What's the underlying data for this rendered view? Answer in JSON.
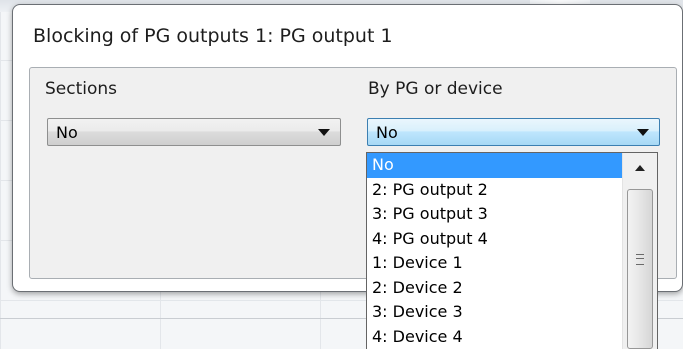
{
  "dialog": {
    "title": "Blocking of PG outputs 1: PG output 1"
  },
  "sections": {
    "label": "Sections",
    "value": "No"
  },
  "by_pg_or_device": {
    "label": "By PG or device",
    "value": "No",
    "options": [
      "No",
      "2: PG output 2",
      "3: PG output 3",
      "4: PG output 4",
      "1: Device 1",
      "2: Device 2",
      "3: Device 3",
      "4: Device 4"
    ],
    "selected_index": 0
  },
  "colors": {
    "selection": "#3399ff",
    "focused_border": "#3c7fb1"
  },
  "icons": {
    "combo_arrow": "chevron-down-icon",
    "scroll_up": "scroll-up-arrow-icon",
    "thumb_grip": "scroll-grip-icon"
  }
}
